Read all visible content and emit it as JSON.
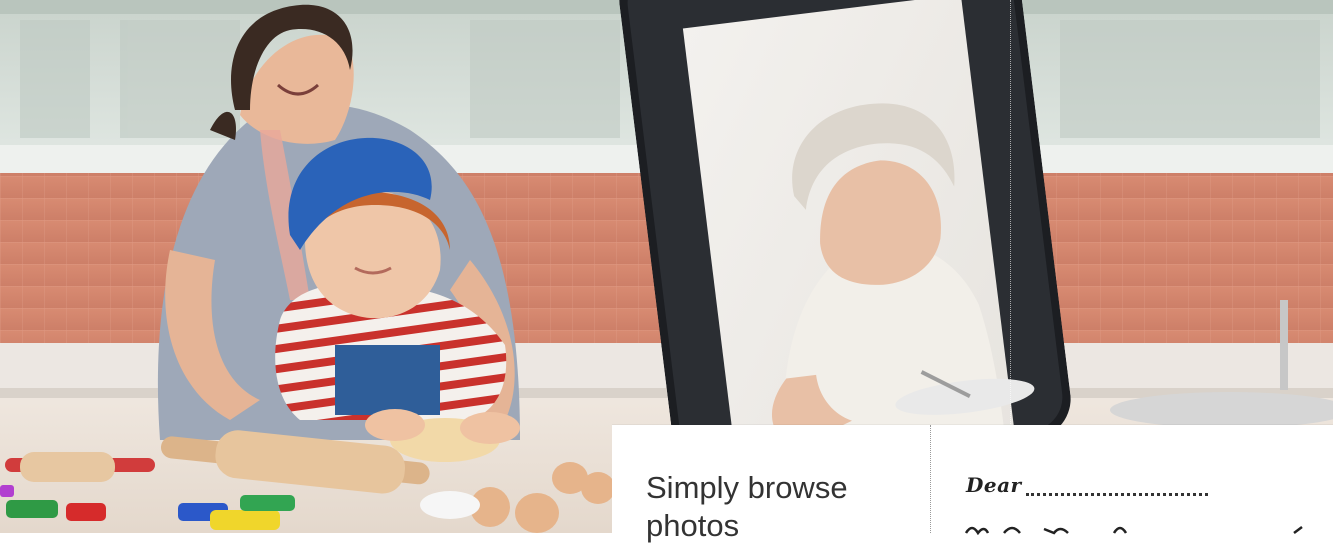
{
  "hero": {
    "alt": "Mother and child baking; grandmother shown on a phone screen"
  },
  "info_card": {
    "headline": "Simply browse photos",
    "note": {
      "salutation": "Dear"
    }
  },
  "colors": {
    "wall_tiles": "#d2826a",
    "cabinets": "#cfd8d2",
    "countertop": "#f4efe9",
    "phone_body": "#1c1e22",
    "child_hat": "#2a63b9",
    "headline_text": "#333333"
  }
}
